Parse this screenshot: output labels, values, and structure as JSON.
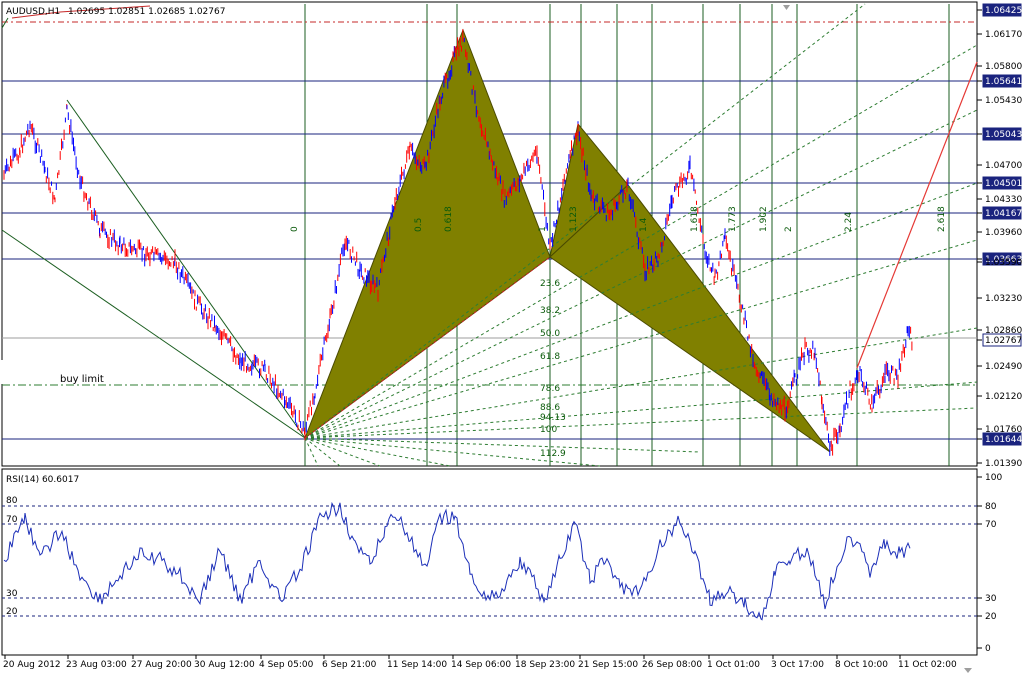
{
  "window": {
    "symbol_label": "AUDUSD,H1",
    "ohlc_label": "1.02695 1.02851 1.02685 1.02767"
  },
  "rsi": {
    "label": "RSI(14) 60.6017",
    "value": 60.6017,
    "levels": [
      "80",
      "70",
      "30",
      "20"
    ],
    "axis_labels": [
      "100",
      "80",
      "70",
      "30",
      "20",
      "0"
    ]
  },
  "price_axis": {
    "labels": [
      "1.06425",
      "1.06170",
      "1.05800",
      "1.05641",
      "1.05430",
      "1.05043",
      "1.04700",
      "1.04501",
      "1.04330",
      "1.04167",
      "1.03960",
      "1.03663",
      "1.03590",
      "1.03230",
      "1.02860",
      "1.02767",
      "1.02490",
      "1.02120",
      "1.01760",
      "1.01644",
      "1.01390"
    ],
    "highlighted": [
      "1.06425",
      "1.05641",
      "1.05043",
      "1.04501",
      "1.04167",
      "1.03663",
      "1.02767",
      "1.01644"
    ]
  },
  "time_axis": {
    "labels": [
      "20 Aug 2012",
      "23 Aug 03:00",
      "27 Aug 20:00",
      "30 Aug 12:00",
      "4 Sep 05:00",
      "6 Sep 21:00",
      "11 Sep 14:00",
      "14 Sep 06:00",
      "18 Sep 23:00",
      "21 Sep 15:00",
      "26 Sep 08:00",
      "1 Oct 01:00",
      "3 Oct 17:00",
      "8 Oct 10:00",
      "11 Oct 02:00"
    ]
  },
  "fib_time_labels": [
    "0",
    "0.5",
    "0.618",
    "1",
    "1.123",
    "1.4",
    "1.618",
    "1.773",
    "1.902",
    "2",
    "2.24",
    "2.618"
  ],
  "fib_fan_labels": [
    "23.6",
    "38.2",
    "50.0",
    "61.8",
    "78.6",
    "88.6",
    "94.13",
    "100",
    "112.9"
  ],
  "order_label": "buy limit",
  "colors": {
    "candle_up": "#0000ff",
    "candle_down": "#ff0000",
    "pattern_fill": "#808000",
    "grid_line": "#1a237e",
    "fib_line": "#2e7d32",
    "rsi_line": "#1c2fb8"
  }
}
